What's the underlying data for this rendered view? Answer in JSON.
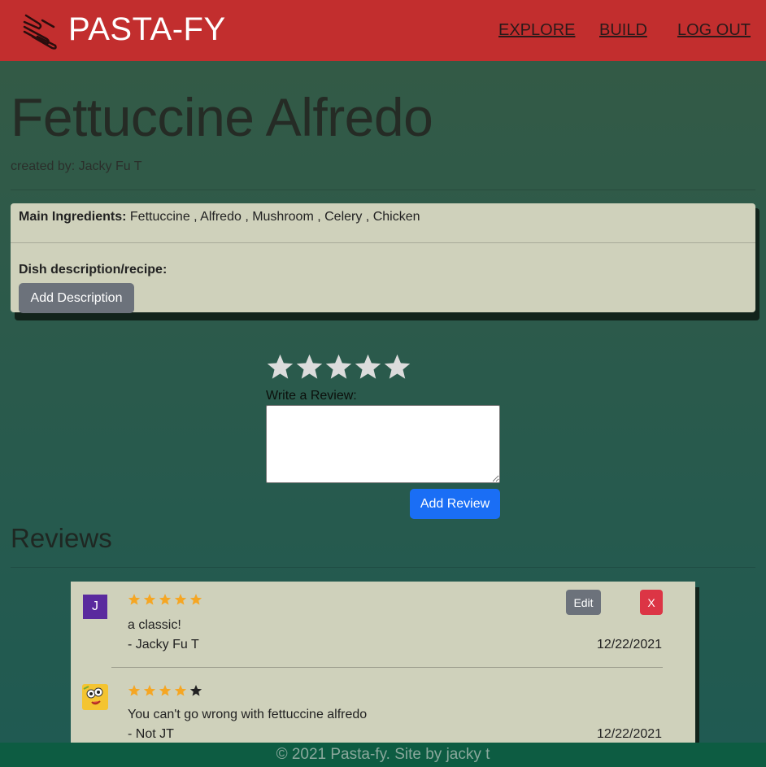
{
  "navbar": {
    "brand": "PASTA-FY",
    "links": {
      "explore": "EXPLORE",
      "build": "BUILD",
      "logout": "LOG OUT"
    },
    "color": "#c22e2e"
  },
  "dish": {
    "title": "Fettuccine Alfredo",
    "created_by": "created by: Jacky Fu T",
    "ingredients_label": "Main Ingredients:",
    "ingredients": "Fettuccine , Alfredo , Mushroom , Celery , Chicken",
    "description_label": "Dish description/recipe:",
    "add_description_label": "Add Description"
  },
  "review_form": {
    "rating": 0,
    "max_rating": 5,
    "write_label": "Write a Review:",
    "textarea_value": "",
    "submit_label": "Add Review"
  },
  "reviews": {
    "heading": "Reviews",
    "items": [
      {
        "avatar_letter": "J",
        "avatar_color": "#5a2a9e",
        "rating": 5,
        "text": "a classic!",
        "author": "- Jacky Fu T",
        "date": "12/22/2021",
        "edit_label": "Edit",
        "delete_label": "X"
      },
      {
        "avatar_icon": "emoji-avatar-icon",
        "rating": 4,
        "text": "You can't go wrong with fettuccine alfredo",
        "author": "- Not JT",
        "date": "12/22/2021"
      }
    ]
  },
  "footer": {
    "text": "© 2021 Pasta-fy. Site by jacky t"
  }
}
